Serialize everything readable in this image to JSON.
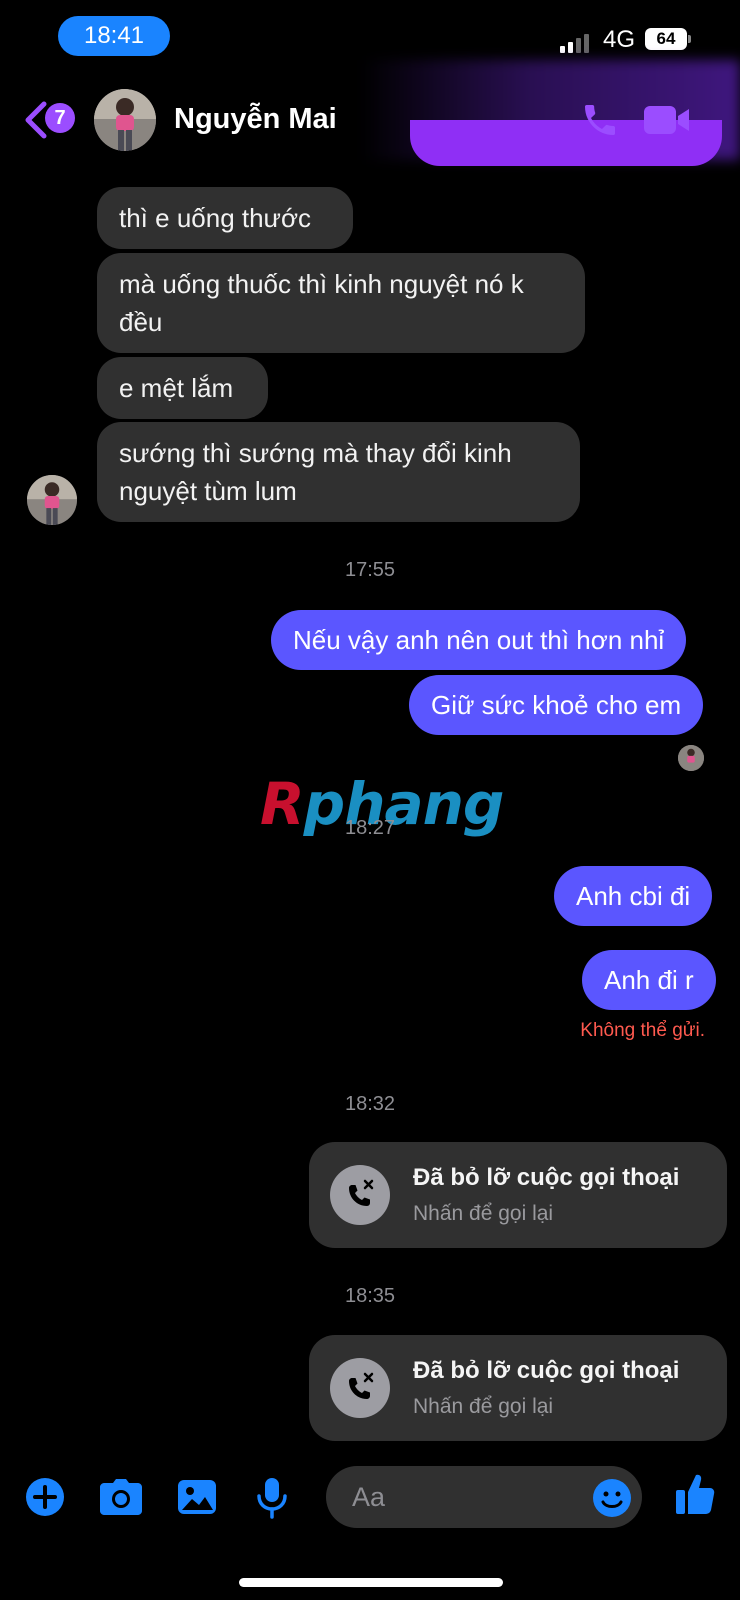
{
  "status_bar": {
    "time": "18:41",
    "network": "4G",
    "battery": "64"
  },
  "header": {
    "unread_count": "7",
    "contact_name": "Nguyễn Mai"
  },
  "messages_incoming": [
    {
      "text": "thì e uống thước"
    },
    {
      "text": "mà uống thuốc thì kinh nguyệt nó k đều"
    },
    {
      "text": "e mệt lắm"
    },
    {
      "text": "sướng thì sướng mà thay đổi kinh nguyệt tùm lum"
    }
  ],
  "timestamps": [
    "17:55",
    "18:27",
    "18:32",
    "18:35"
  ],
  "messages_outgoing": [
    {
      "text": "Nếu vậy anh nên out thì hơn nhỉ"
    },
    {
      "text": "Giữ sức khoẻ cho em"
    },
    {
      "text": "Anh cbi đi"
    },
    {
      "text": "Anh đi r"
    }
  ],
  "send_error": "Không thể gửi.",
  "watermark": {
    "first": "R",
    "rest": "phang"
  },
  "missed_calls": [
    {
      "title": "Đã bỏ lỡ cuộc gọi thoại",
      "subtitle": "Nhấn để gọi lại"
    },
    {
      "title": "Đã bỏ lỡ cuộc gọi thoại",
      "subtitle": "Nhấn để gọi lại"
    }
  ],
  "composer": {
    "placeholder": "Aa"
  },
  "colors": {
    "accent": "#5b56ff",
    "header_accent": "#9b4dff",
    "icon_blue": "#1a84ff",
    "incoming_bubble": "#303030",
    "error": "#ff5a4f"
  },
  "icons": [
    "back-arrow-icon",
    "phone-icon",
    "video-camera-icon",
    "plus-icon",
    "camera-icon",
    "image-icon",
    "microphone-icon",
    "emoji-icon",
    "thumbs-up-icon",
    "missed-call-icon"
  ]
}
